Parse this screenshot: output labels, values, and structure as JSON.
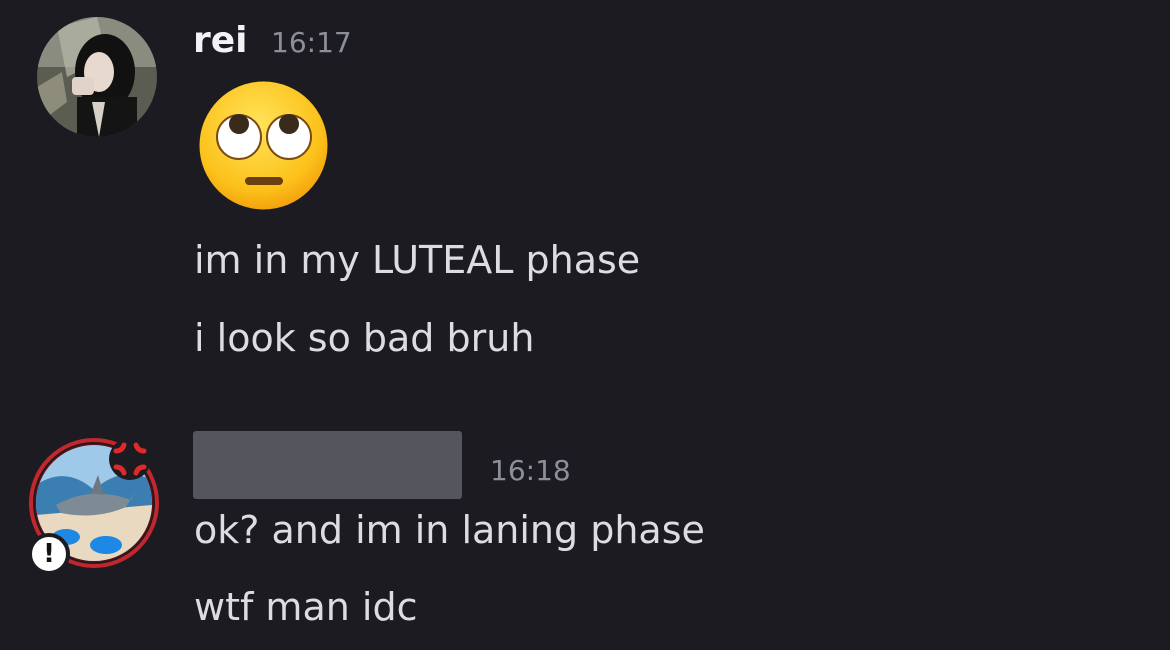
{
  "messages": [
    {
      "author": "rei",
      "time": "16:17",
      "emoji_name": "face-with-rolling-eyes",
      "lines": [
        "im in my LUTEAL phase",
        "i look so bad bruh"
      ]
    },
    {
      "author": "",
      "time": "16:18",
      "lines": [
        "ok? and im in laning phase",
        "wtf man idc"
      ]
    }
  ],
  "badge": {
    "text": "!"
  },
  "icons": {
    "avatar_1": "user-photo-avatar",
    "avatar_2": "shark-avatar",
    "status": "anger-symbol-icon",
    "badge": "alert-badge-icon"
  },
  "colors": {
    "background": "#1b1b21",
    "username": "#f2f3f5",
    "text": "#dcdde2",
    "timestamp": "#8d8f98",
    "redacted": "#55565d",
    "avatar_ring": "#c1272d"
  }
}
